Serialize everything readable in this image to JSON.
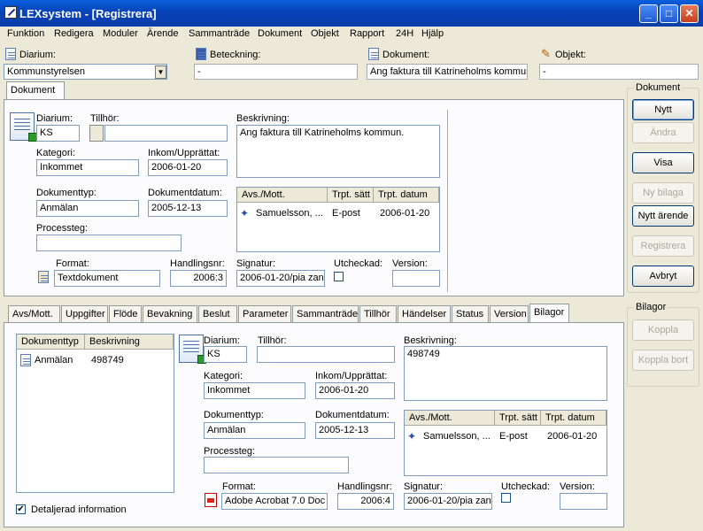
{
  "window": {
    "title": "LEXsystem - [Registrera]",
    "min": "_",
    "max": "□",
    "close": "✕"
  },
  "menu": [
    "Funktion",
    "Redigera",
    "Moduler",
    "Ärende",
    "Sammanträde",
    "Dokument",
    "Objekt",
    "Rapport",
    "24H",
    "Hjälp"
  ],
  "top": {
    "diarium_label": "Diarium:",
    "diarium_value": "Kommunstyrelsen",
    "beteckning_label": "Beteckning:",
    "beteckning_value": "-",
    "dokument_label": "Dokument:",
    "dokument_value": "Ang faktura till Katrineholms kommun.",
    "objekt_label": "Objekt:",
    "objekt_value": "-"
  },
  "doc_tab": "Dokument",
  "doc": {
    "diarium_label": "Diarium:",
    "diarium_value": "KS",
    "tillhor_label": "Tillhör:",
    "tillhor_value": "",
    "beskrivning_label": "Beskrivning:",
    "beskrivning_value": "Ang faktura till Katrineholms kommun.",
    "kategori_label": "Kategori:",
    "kategori_value": "Inkommet",
    "inkom_label": "Inkom/Upprättat:",
    "inkom_value": "2006-01-20",
    "doktyp_label": "Dokumenttyp:",
    "doktyp_value": "Anmälan",
    "dokdatum_label": "Dokumentdatum:",
    "dokdatum_value": "2005-12-13",
    "processteg_label": "Processteg:",
    "processteg_value": "",
    "format_label": "Format:",
    "format_value": "Textdokument",
    "handlingsnr_label": "Handlingsnr:",
    "handlingsnr_value": "2006:3",
    "signatur_label": "Signatur:",
    "signatur_value": "2006-01-20/pia zan",
    "utcheckad_label": "Utcheckad:",
    "version_label": "Version:",
    "version_value": "",
    "avs_headers": [
      "Avs./Mott.",
      "Trpt. sätt",
      "Trpt. datum"
    ],
    "avs_rows": [
      [
        "Samuelsson, ...",
        "E-post",
        "2006-01-20"
      ]
    ]
  },
  "tabs": [
    "Avs/Mott.",
    "Uppgifter",
    "Flöde",
    "Bevakning",
    "Beslut",
    "Parameter",
    "Sammanträde",
    "Tillhör",
    "Händelser",
    "Status",
    "Version",
    "Bilagor"
  ],
  "bilagor": {
    "list_headers": [
      "Dokumenttyp",
      "Beskrivning"
    ],
    "list_rows": [
      [
        "Anmälan",
        "498749"
      ]
    ],
    "detail_label": "Detaljerad information",
    "diarium_label": "Diarium:",
    "diarium_value": "KS",
    "tillhor_label": "Tillhör:",
    "tillhor_value": "",
    "beskrivning_label": "Beskrivning:",
    "beskrivning_value": "498749",
    "kategori_label": "Kategori:",
    "kategori_value": "Inkommet",
    "inkom_label": "Inkom/Upprättat:",
    "inkom_value": "2006-01-20",
    "doktyp_label": "Dokumenttyp:",
    "doktyp_value": "Anmälan",
    "dokdatum_label": "Dokumentdatum:",
    "dokdatum_value": "2005-12-13",
    "processteg_label": "Processteg:",
    "processteg_value": "",
    "format_label": "Format:",
    "format_value": "Adobe Acrobat 7.0 Doc",
    "handlingsnr_label": "Handlingsnr:",
    "handlingsnr_value": "2006:4",
    "signatur_label": "Signatur:",
    "signatur_value": "2006-01-20/pia zan",
    "utcheckad_label": "Utcheckad:",
    "version_label": "Version:",
    "version_value": "",
    "avs_headers": [
      "Avs./Mott.",
      "Trpt. sätt",
      "Trpt. datum"
    ],
    "avs_rows": [
      [
        "Samuelsson, ...",
        "E-post",
        "2006-01-20"
      ]
    ]
  },
  "side": {
    "dokument_group": "Dokument",
    "nytt": "Nytt",
    "andra": "Ändra",
    "visa": "Visa",
    "ny_bilaga": "Ny bilaga",
    "nytt_arende": "Nytt ärende",
    "registrera": "Registrera",
    "avbryt": "Avbryt",
    "bilagor_group": "Bilagor",
    "koppla": "Koppla",
    "koppla_bort": "Koppla bort"
  }
}
